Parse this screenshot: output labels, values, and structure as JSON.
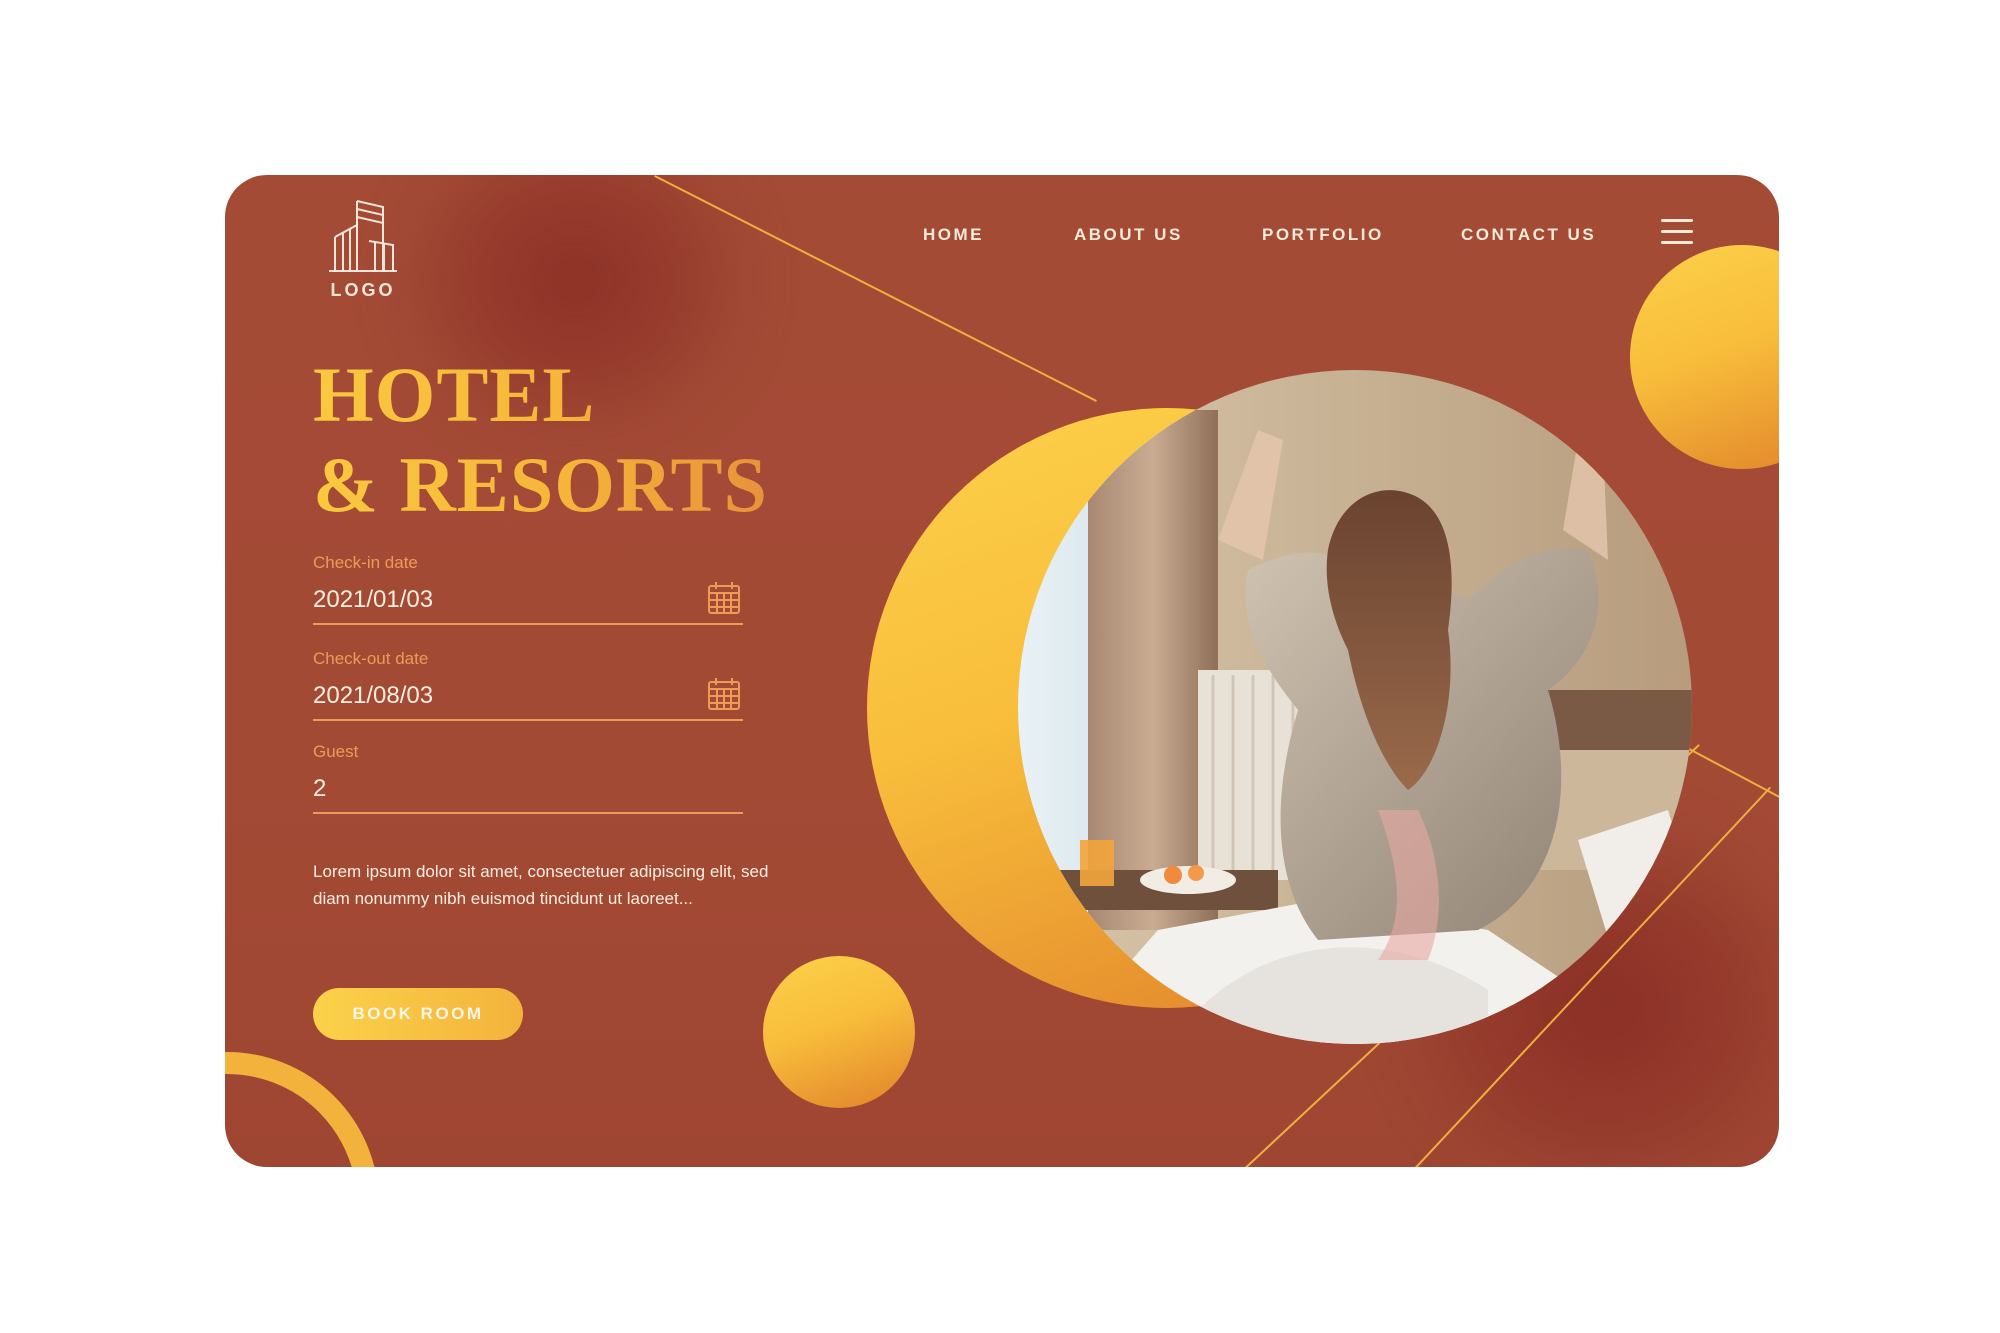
{
  "brand": {
    "logo_text": "LOGO"
  },
  "nav": {
    "items": [
      {
        "label": "HOME"
      },
      {
        "label": "ABOUT US"
      },
      {
        "label": "PORTFOLIO"
      },
      {
        "label": "CONTACT US"
      }
    ],
    "menu_icon": "hamburger-menu-icon"
  },
  "hero": {
    "title_line1": "HOTEL",
    "title_line2": "& RESORTS"
  },
  "form": {
    "checkin": {
      "label": "Check-in date",
      "value": "2021/01/03",
      "icon": "calendar-icon"
    },
    "checkout": {
      "label": "Check-out date",
      "value": "2021/08/03",
      "icon": "calendar-icon"
    },
    "guest": {
      "label": "Guest",
      "value": "2"
    }
  },
  "description": "Lorem ipsum dolor sit amet, consectetuer adipiscing elit, sed diam nonummy nibh euismod tincidunt ut laoreet...",
  "cta": {
    "label": "BOOK ROOM"
  },
  "colors": {
    "background": "#a44b36",
    "accent_gold": "#f8bd3b",
    "accent_orange": "#e0822a",
    "label_orange": "#ee9a57",
    "text_light": "#fbeede"
  }
}
